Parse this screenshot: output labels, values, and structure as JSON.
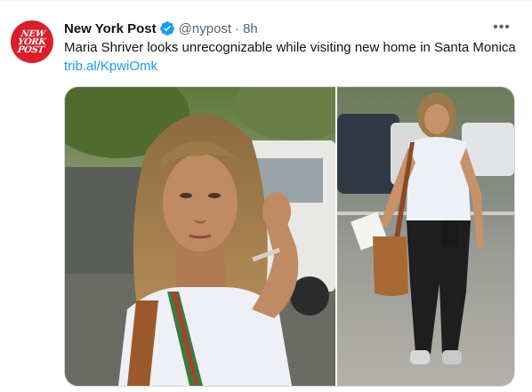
{
  "tweet": {
    "account_name": "New York Post",
    "handle": "@nypost",
    "separator": "·",
    "time": "8h",
    "text": "Maria Shriver looks unrecognizable while visiting new home in Santa Monica",
    "link": "trib.al/KpwiOmk",
    "more_label": "•••",
    "avatar_text": "NEW\nYORK\nPOST",
    "icons": {
      "verified": "verified-badge-icon",
      "more": "more-options-icon"
    },
    "colors": {
      "avatar_bg": "#d8202a",
      "verified": "#1d9bf0",
      "link": "#1d9bf0",
      "muted": "#536471"
    }
  }
}
